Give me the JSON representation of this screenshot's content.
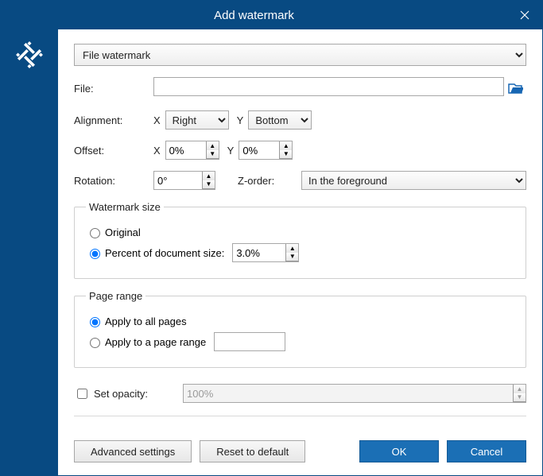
{
  "title": "Add watermark",
  "type_select": "File watermark",
  "labels": {
    "file": "File:",
    "alignment": "Alignment:",
    "offset": "Offset:",
    "rotation": "Rotation:",
    "zorder": "Z-order:",
    "X": "X",
    "Y": "Y"
  },
  "values": {
    "file": "",
    "alignX": "Right",
    "alignY": "Bottom",
    "offsetX": "0%",
    "offsetY": "0%",
    "rotation": "0°",
    "zorder": "In the foreground"
  },
  "size": {
    "legend": "Watermark size",
    "opt_original": "Original",
    "opt_percent": "Percent of document size:",
    "percent_value": "3.0%",
    "selected": "percent"
  },
  "range": {
    "legend": "Page range",
    "opt_all": "Apply to all pages",
    "opt_range": "Apply to a page range",
    "range_value": "",
    "selected": "all"
  },
  "opacity": {
    "label": "Set opacity:",
    "value": "100%",
    "enabled": false
  },
  "buttons": {
    "advanced": "Advanced settings",
    "reset": "Reset to default",
    "ok": "OK",
    "cancel": "Cancel"
  }
}
